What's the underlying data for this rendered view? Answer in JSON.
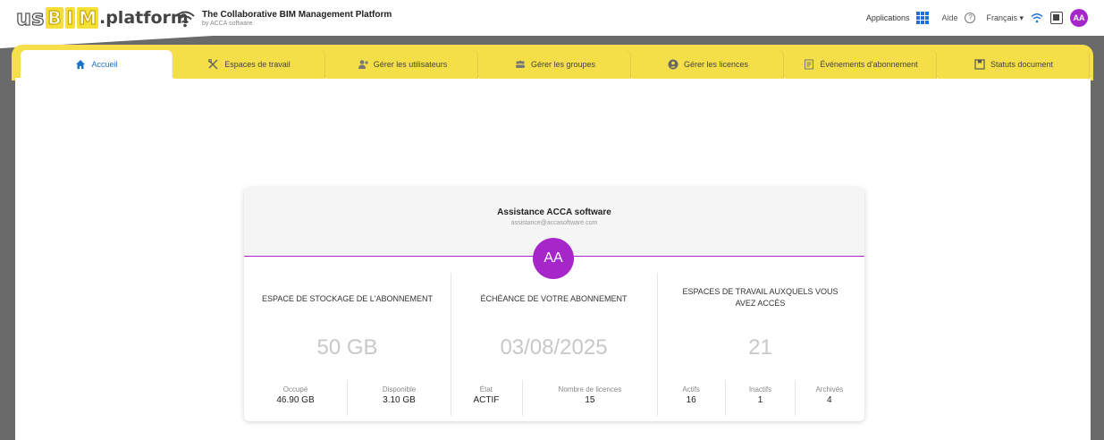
{
  "header": {
    "logo_us": "us",
    "logo_bim": [
      "B",
      "I",
      "M"
    ],
    "logo_platform": ".platform",
    "tagline_title": "The Collaborative BIM Management Platform",
    "tagline_sub": "by ACCA software",
    "applications_label": "Applications",
    "help_label": "Aide",
    "language_label": "Français ▾",
    "avatar_initials": "AA"
  },
  "tabs": [
    {
      "label": "Accueil",
      "icon": "home-icon",
      "active": true
    },
    {
      "label": "Espaces de travail",
      "icon": "tools-icon"
    },
    {
      "label": "Gérer les utilisateurs",
      "icon": "add-user-icon"
    },
    {
      "label": "Gérer les groupes",
      "icon": "group-icon"
    },
    {
      "label": "Gérer les licences",
      "icon": "license-icon"
    },
    {
      "label": "Événements d'abonnement",
      "icon": "events-icon"
    },
    {
      "label": "Statuts document",
      "icon": "document-status-icon"
    }
  ],
  "account": {
    "name": "Assistance ACCA software",
    "email": "assistance@accasoftware.com",
    "initials": "AA"
  },
  "panels": {
    "storage": {
      "title": "ESPACE DE STOCKAGE DE L'ABONNEMENT",
      "value": "50 GB",
      "stats": [
        {
          "label": "Occupé",
          "value": "46.90 GB"
        },
        {
          "label": "Disponible",
          "value": "3.10 GB"
        }
      ]
    },
    "subscription": {
      "title": "ÉCHÉANCE DE VOTRE ABONNEMENT",
      "value": "03/08/2025",
      "stats": [
        {
          "label": "État",
          "value": "ACTIF"
        },
        {
          "label": "Nombre de licences",
          "value": "15"
        }
      ]
    },
    "workspaces": {
      "title": "ESPACES DE TRAVAIL AUXQUELS VOUS AVEZ ACCÈS",
      "value": "21",
      "stats": [
        {
          "label": "Actifs",
          "value": "16"
        },
        {
          "label": "Inactifs",
          "value": "1"
        },
        {
          "label": "Archivés",
          "value": "4"
        }
      ]
    }
  },
  "colors": {
    "accent_purple": "#a626c9",
    "tab_yellow": "#f5df48",
    "active_tab_text": "#1a73c9",
    "frame_grey": "#6a6a6a"
  }
}
